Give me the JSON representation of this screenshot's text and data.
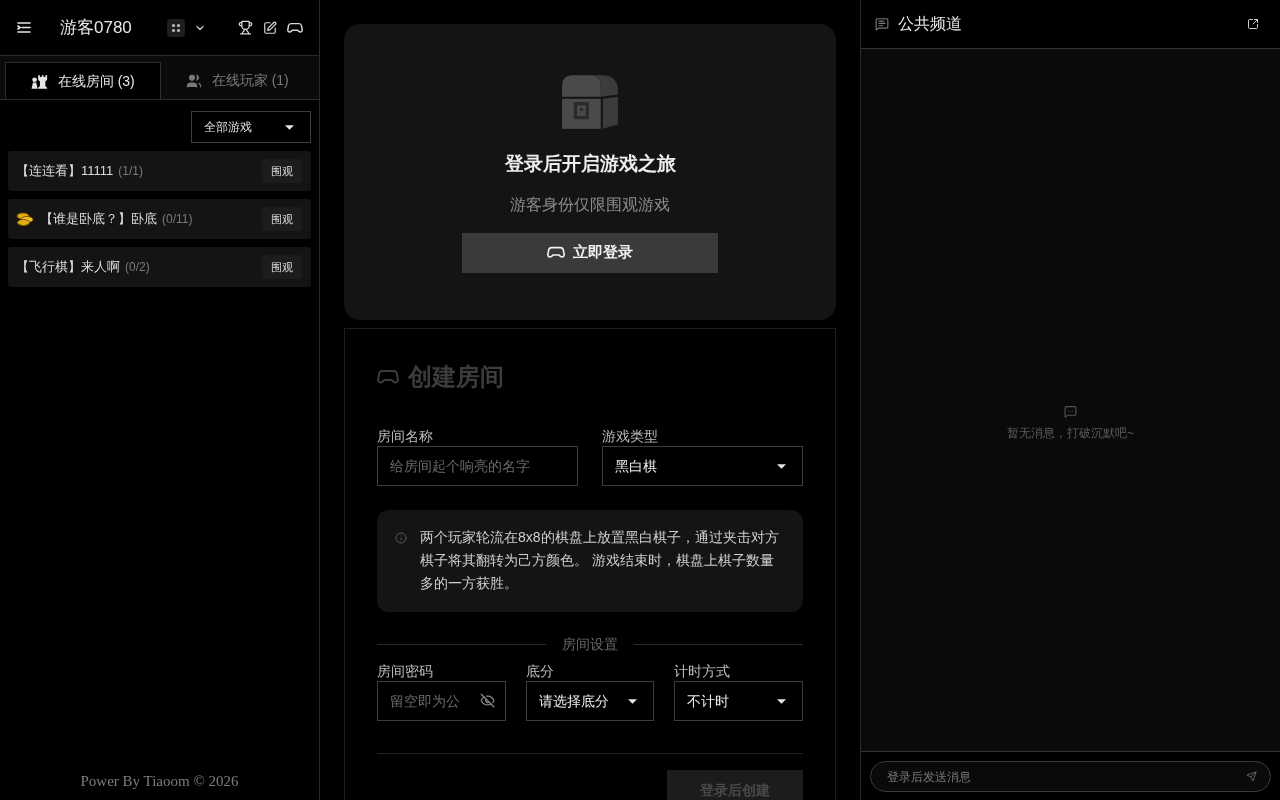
{
  "sidebar": {
    "header": {
      "title": "游客0780"
    },
    "tabs": [
      {
        "kind": "rooms",
        "label": "在线房间 (3)",
        "selected": true
      },
      {
        "kind": "players",
        "label": "在线玩家 (1)",
        "selected": false
      }
    ],
    "filter": {
      "value": "全部游戏"
    },
    "rooms": [
      {
        "title": "【连连看】11111",
        "count": "(1/1)",
        "coin_badge": false,
        "action": "围观"
      },
      {
        "title": "【谁是卧底？】卧底",
        "count": "(0/11)",
        "coin_badge": true,
        "action": "围观"
      },
      {
        "title": "【飞行棋】来人啊",
        "count": "(0/2)",
        "coin_badge": false,
        "action": "围观"
      }
    ],
    "footer": "Power By Tiaoom © 2026"
  },
  "login_card": {
    "title": "登录后开启游戏之旅",
    "subtitle": "游客身份仅限围观游戏",
    "button": "立即登录"
  },
  "create_room": {
    "title": "创建房间",
    "fields": [
      {
        "kind": "input",
        "label": "房间名称",
        "placeholder": "给房间起个响亮的名字"
      },
      {
        "kind": "select",
        "label": "游戏类型",
        "value": "黑白棋"
      }
    ],
    "description": "两个玩家轮流在8x8的棋盘上放置黑白棋子，通过夹击对方棋子将其翻转为己方颜色。 游戏结束时，棋盘上棋子数量多的一方获胜。",
    "section": "房间设置",
    "settings": [
      {
        "kind": "password",
        "label": "房间密码",
        "placeholder": "留空即为公"
      },
      {
        "kind": "select",
        "label": "底分",
        "value": "请选择底分"
      },
      {
        "kind": "select",
        "label": "计时方式",
        "value": "不计时"
      }
    ],
    "submit": {
      "label": "登录后创建",
      "disabled": true
    }
  },
  "chat": {
    "title": "公共频道",
    "empty": "暂无消息，打破沉默吧~",
    "input": {
      "placeholder": "登录后发送消息"
    }
  }
}
